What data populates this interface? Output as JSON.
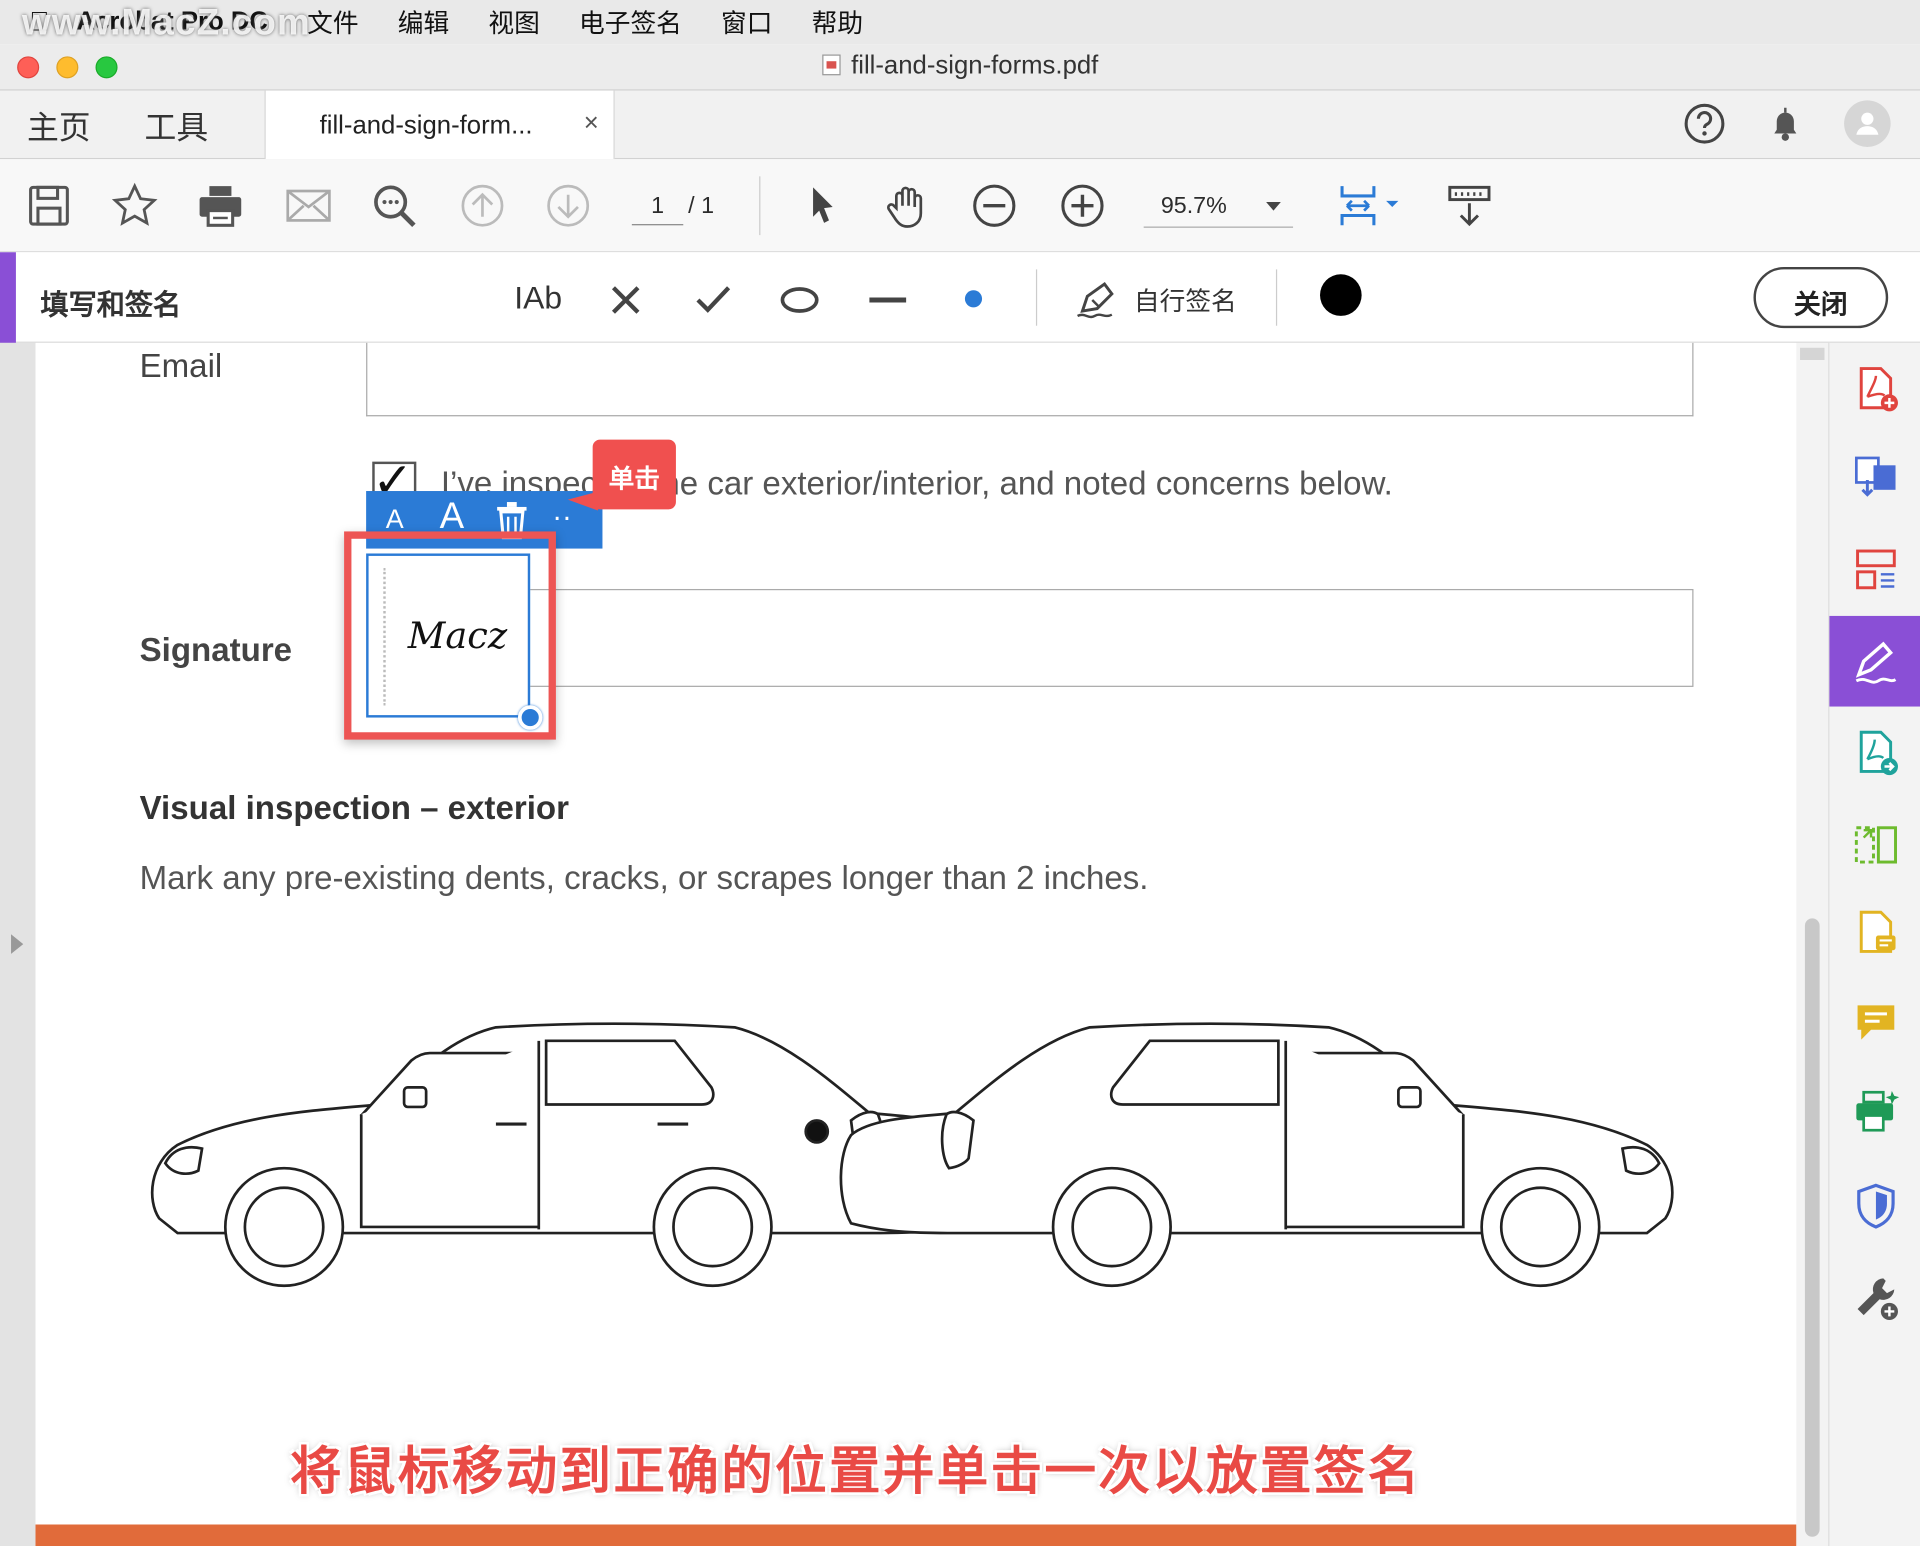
{
  "menubar": {
    "app": "Acrobat Pro DC",
    "items": [
      "文件",
      "编辑",
      "视图",
      "电子签名",
      "窗口",
      "帮助"
    ],
    "watermark": "www.MacZ.com"
  },
  "window": {
    "title": "fill-and-sign-forms.pdf"
  },
  "tabs": {
    "home": "主页",
    "tools": "工具",
    "document": "fill-and-sign-form...",
    "close": "×"
  },
  "toolbar": {
    "page_current": "1",
    "page_total": "/ 1",
    "zoom": "95.7%"
  },
  "fill_sign": {
    "title": "填写和签名",
    "text_tool": "IAb",
    "sign_self": "自行签名",
    "close": "关闭",
    "ink_color": "#000000"
  },
  "document": {
    "email_label": "Email",
    "checkbox_text": "I’ve inspected the car exterior/interior, and noted concerns below.",
    "checkbox_checked": true,
    "signature_label": "Signature",
    "signature_value": "Macz",
    "section_title": "Visual inspection – exterior",
    "section_instruction": "Mark any pre-existing dents, cracks, or scrapes longer than 2 inches."
  },
  "sig_toolbar": {
    "small_a": "A",
    "large_a": "A",
    "more": "··"
  },
  "callout": "单击",
  "subtitle": "将鼠标移动到正确的位置并单击一次以放置签名",
  "colors": {
    "accent": "#8a4fd6",
    "selection": "#2b7bd6",
    "highlight": "#ed5554",
    "footer_bar": "#e16b3a"
  }
}
